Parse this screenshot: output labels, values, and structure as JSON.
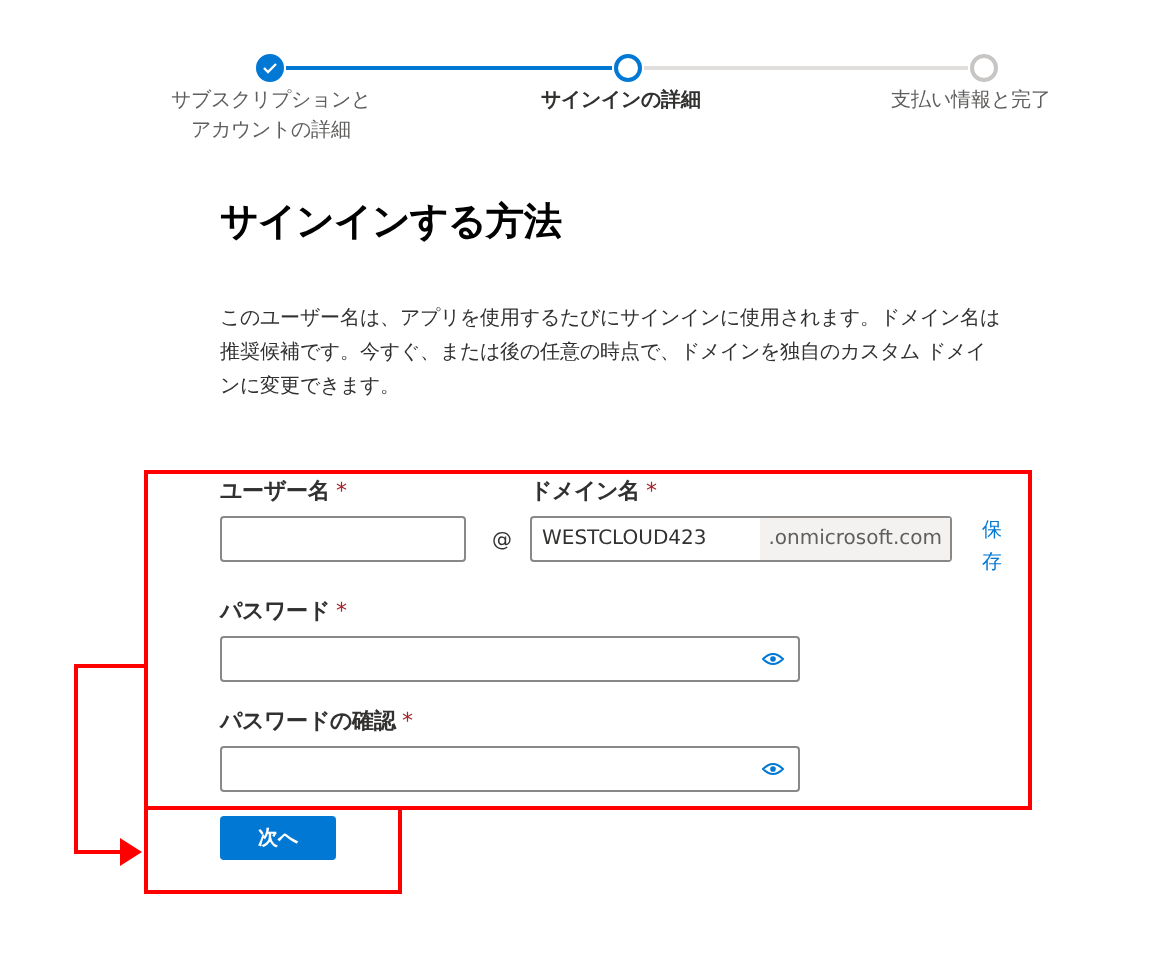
{
  "stepper": [
    {
      "label": "サブスクリプションとアカウントの詳細",
      "completed": true,
      "selected": false
    },
    {
      "label": "サインインの詳細",
      "completed": false,
      "selected": true
    },
    {
      "label": "支払い情報と完了",
      "completed": false,
      "selected": false
    }
  ],
  "heading": "サインインする方法",
  "description": "このユーザー名は、アプリを使用するたびにサインインに使用されます。ドメイン名は推奨候補です。今すぐ、または後の任意の時点で、ドメインを独自のカスタム ドメインに変更できます。",
  "username": {
    "label": "ユーザー名",
    "required_mark": "*"
  },
  "at_sign": "@",
  "domain": {
    "label": "ドメイン名",
    "required_mark": "*",
    "value": "WESTCLOUD423",
    "suffix": ".onmicrosoft.com",
    "save_link": "保存"
  },
  "password_fields": [
    {
      "label": "パスワード",
      "required_mark": "*"
    },
    {
      "label": "パスワードの確認",
      "required_mark": "*"
    }
  ],
  "next_button": "次へ"
}
